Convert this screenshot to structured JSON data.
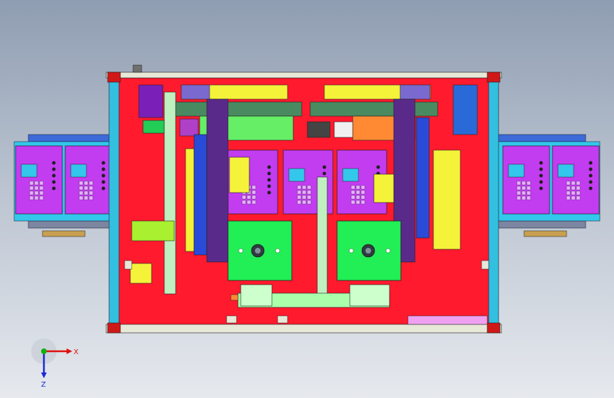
{
  "viewport": {
    "description_free": true,
    "colors": {
      "background_top": "#8f9db2",
      "background_bottom": "#e6e9ee",
      "base_plate": "#ff1a2e",
      "frame_rail": "#33bfe0",
      "machine_magenta": "#c23cf0",
      "module_green": "#22ee55",
      "bar_yellow": "#f4f33a",
      "panel_blue": "#33a2ff",
      "gantry_purple": "#6a2ab8"
    }
  },
  "triad": {
    "x_label": "X",
    "z_label": "Z",
    "x_color": "#e01010",
    "y_color": "#10b010",
    "z_color": "#1a28d8"
  }
}
